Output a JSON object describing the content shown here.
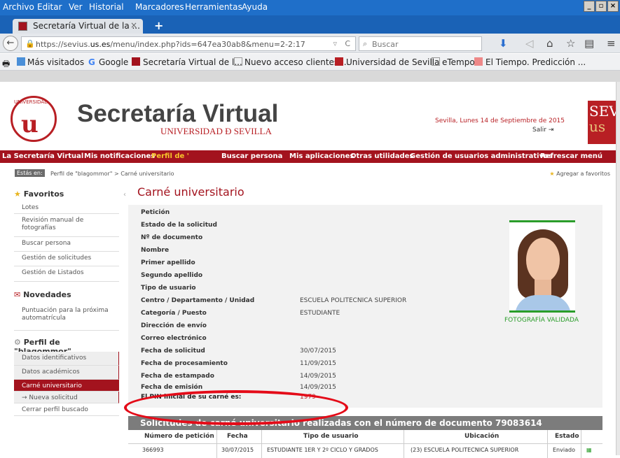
{
  "browser": {
    "menu": [
      "Archivo",
      "Editar",
      "Ver",
      "Historial",
      "Marcadores",
      "Herramientas",
      "Ayuda"
    ],
    "tab_title": "Secretaría Virtual de la ...",
    "tab_close": "×",
    "new_tab": "+",
    "url_prefix": "https://sevius.",
    "url_domain": "us.es",
    "url_rest": "/menu/index.php?ids=647ea30ab8&menu=2-2:17",
    "search_placeholder": "Buscar",
    "bookmarks": [
      "Más visitados",
      "Google",
      "Secretaría Virtual de l...",
      "Nuevo acceso clientes ...",
      "Universidad de Sevilla",
      "eTempo",
      "El Tiempo. Predicción ..."
    ]
  },
  "header": {
    "title": "Secretaría Virtual",
    "subtitle": "UNIVERSIDAD Ð SEVILLA",
    "date": "Sevilla, Lunes 14 de Septiembre de 2015",
    "salir": "Salir",
    "logo_text": "SEVI",
    "logo_sub": "us"
  },
  "red_menu": [
    "La Secretaría Virtual",
    "Mis notificaciones",
    "Perfil de '",
    "Buscar persona",
    "Mis aplicaciones",
    "Otras utilidades",
    "Gestión de usuarios administrativos",
    "Refrescar menú"
  ],
  "breadcrumb": {
    "label": "Estás en:",
    "path": "Perfil de \"blagommor\" > Carné universitario",
    "add_fav": "Agregar a favoritos"
  },
  "sidebar": {
    "favoritos_title": "Favoritos",
    "favoritos": [
      "Lotes",
      "Revisión manual de fotografías",
      "Buscar persona",
      "Gestión de solicitudes",
      "Gestión de Listados"
    ],
    "novedades_title": "Novedades",
    "novedades": [
      "Puntuación para la próxima automatrícula"
    ],
    "perfil_title": "Perfil de \"blagommor\"",
    "perfil": [
      "Datos identificativos",
      "Datos académicos",
      "Carné universitario",
      "→  Nueva solicitud",
      "Cerrar perfil buscado"
    ]
  },
  "main": {
    "title": "Carné universitario",
    "fields": [
      {
        "label": "Petición",
        "value": ""
      },
      {
        "label": "Estado de la solicitud",
        "value": ""
      },
      {
        "label": "Nº de documento",
        "value": ""
      },
      {
        "label": "Nombre",
        "value": ""
      },
      {
        "label": "Primer apellido",
        "value": ""
      },
      {
        "label": "Segundo apellido",
        "value": ""
      },
      {
        "label": "Tipo de usuario",
        "value": ""
      },
      {
        "label": "Centro / Departamento / Unidad",
        "value": "ESCUELA POLITECNICA SUPERIOR"
      },
      {
        "label": "Categoría / Puesto",
        "value": "ESTUDIANTE"
      },
      {
        "label": "Dirección de envío",
        "value": ""
      },
      {
        "label": "Correo electrónico",
        "value": ""
      },
      {
        "label": "Fecha de solicitud",
        "value": "30/07/2015"
      },
      {
        "label": "Fecha de procesamiento",
        "value": "11/09/2015"
      },
      {
        "label": "Fecha de estampado",
        "value": "14/09/2015"
      },
      {
        "label": "Fecha de emisión",
        "value": "14/09/2015"
      }
    ],
    "photo_status": "FOTOGRAFÍA VALIDADA",
    "pin_label": "El PIN inicial de su carné es:",
    "pin_value": "1979",
    "solicitudes_title": "Solicitudes de carné universitario realizadas con el número de documento 79083614",
    "table": {
      "headers": [
        "Número de petición",
        "Fecha",
        "Tipo de usuario",
        "Ubicación",
        "Estado"
      ],
      "rows": [
        [
          "366993",
          "30/07/2015",
          "ESTUDIANTE 1ER Y 2º CICLO Y GRADOS",
          "(23) ESCUELA POLITECNICA SUPERIOR",
          "Enviado"
        ]
      ]
    }
  }
}
